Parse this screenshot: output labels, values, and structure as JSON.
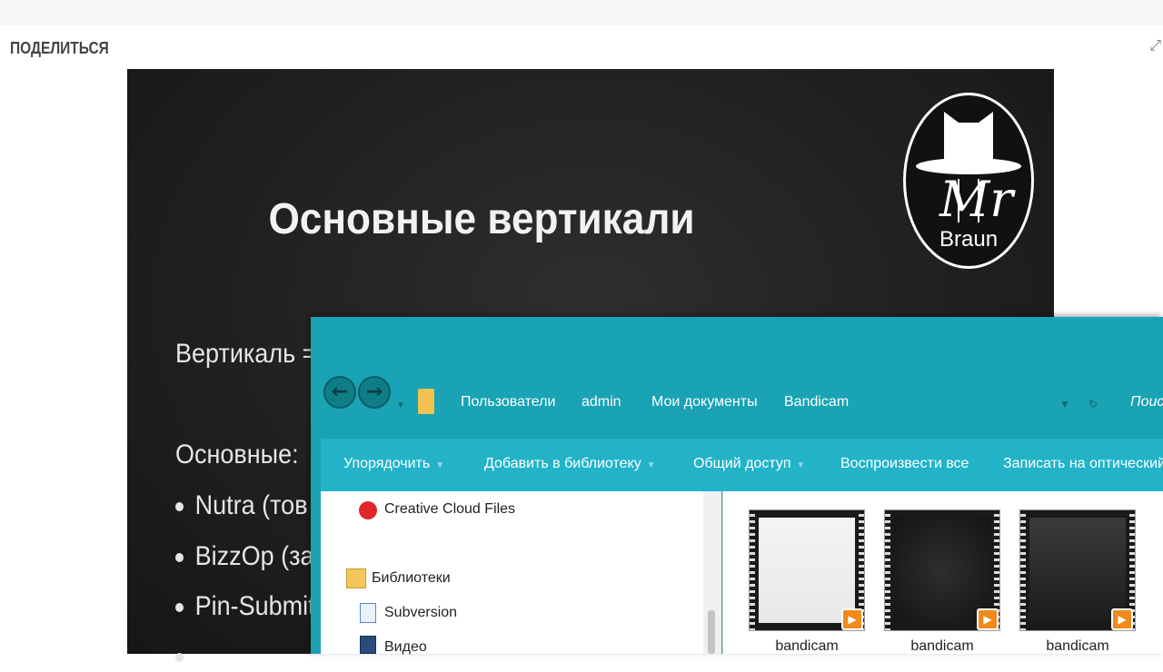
{
  "page": {
    "share_label": "ПОДЕЛИТЬСЯ"
  },
  "slide": {
    "title": "Основные вертикали",
    "lines": [
      "Вертикаль =",
      "Основные:"
    ],
    "bullets": [
      "Nutra (тов",
      "BizzOp (за",
      "Pin-Submit"
    ],
    "logo": {
      "line1": "Mr",
      "line2": "Braun"
    }
  },
  "explorer": {
    "breadcrumbs": [
      "Пользователи",
      "admin",
      "Мои документы",
      "Bandicam"
    ],
    "search_label": "Поис",
    "toolbar": [
      {
        "label": "Упорядочить",
        "has_dropdown": true
      },
      {
        "label": "Добавить в библиотеку",
        "has_dropdown": true
      },
      {
        "label": "Общий доступ",
        "has_dropdown": true
      },
      {
        "label": "Воспроизвести все",
        "has_dropdown": false
      },
      {
        "label": "Записать на оптический",
        "has_dropdown": false
      }
    ],
    "tree": [
      {
        "label": "Creative Cloud Files",
        "icon": "creative-cloud-icon"
      },
      {
        "label": "Библиотеки",
        "icon": "libraries-folder-icon"
      },
      {
        "label": "Subversion",
        "icon": "document-icon"
      },
      {
        "label": "Видео",
        "icon": "video-library-icon"
      }
    ],
    "files": [
      "bandicam",
      "bandicam",
      "bandicam"
    ]
  },
  "colors": {
    "explorer_header": "#19a3b4",
    "command_bar": "#22b3c9",
    "slide_bg": "#1f1f1f",
    "play_badge": "#f08a1c"
  }
}
